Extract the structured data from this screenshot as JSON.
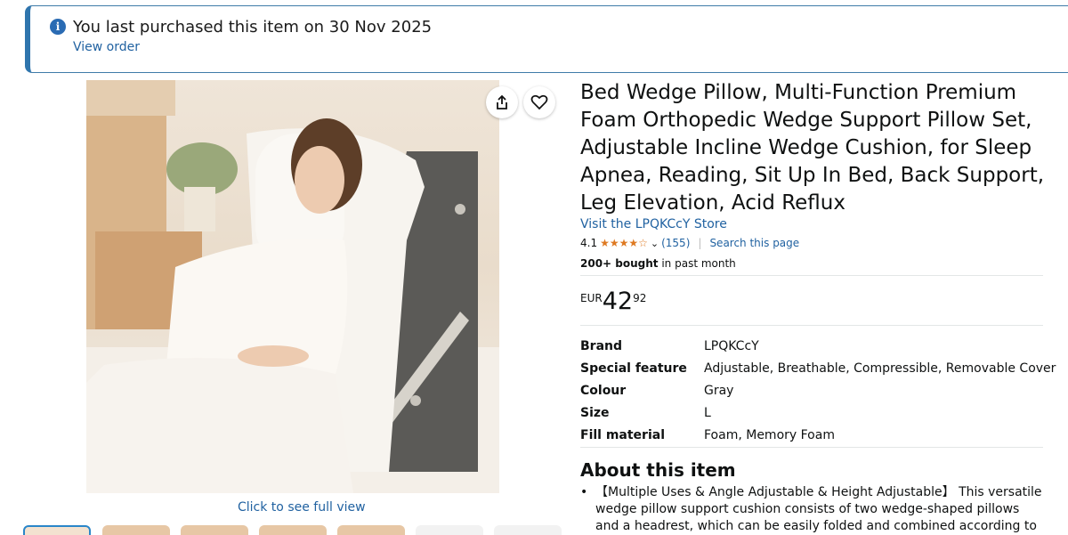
{
  "notice": {
    "message": "You last purchased this item on 30 Nov 2025",
    "link": "View order",
    "icon": "info-icon",
    "accent": "#2f75ad"
  },
  "gallery": {
    "caption": "Click to see full view",
    "share_icon": "share-icon",
    "favorite_icon": "heart-icon"
  },
  "product": {
    "title": "Bed Wedge Pillow, Multi-Function Premium Foam Orthopedic Wedge Support Pillow Set, Adjustable Incline Wedge Cushion, for Sleep Apnea, Reading, Sit Up In Bed, Back Support, Leg Elevation, Acid Reflux",
    "store_link": "Visit the LPQKCcY Store",
    "rating": "4.1",
    "stars": "★★★★☆",
    "rating_count": "(155)",
    "search_link": "Search this page",
    "bought_bold": "200+ bought",
    "bought_rest": " in past month",
    "price": {
      "currency": "EUR",
      "whole": "42",
      "fraction": "92"
    }
  },
  "specs": [
    {
      "label": "Brand",
      "value": "LPQKCcY"
    },
    {
      "label": "Special feature",
      "value": "Adjustable, Breathable, Compressible, Removable Cover"
    },
    {
      "label": "Colour",
      "value": "Gray"
    },
    {
      "label": "Size",
      "value": "L"
    },
    {
      "label": "Fill material",
      "value": "Foam, Memory Foam"
    }
  ],
  "about": {
    "title": "About this item",
    "bullets": [
      "【Multiple Uses & Angle Adjustable & Height Adjustable】 This versatile wedge pillow support cushion consists of two wedge-shaped pillows and a headrest, which can be easily folded and combined according to your needs. It can provide"
    ]
  },
  "colors": {
    "link": "#2162a1",
    "star": "#de7921"
  }
}
